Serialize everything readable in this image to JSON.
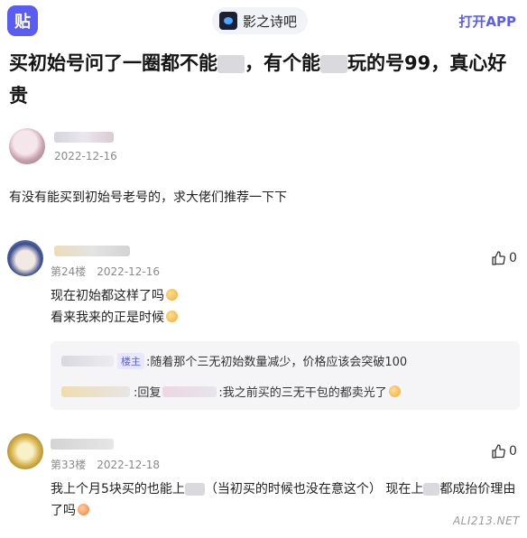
{
  "topbar": {
    "app_icon_glyph": "贴",
    "forum_name": "影之诗吧",
    "open_app_label": "打开APP",
    "accent_color": "#5b5df2"
  },
  "post": {
    "title_part1": "买初始号问了一圈都不能",
    "title_part2": "，有个能",
    "title_part3": "玩的号99，真心好贵",
    "date": "2022-12-16",
    "body": "有没有能买到初始号老号的，求大佬们推荐一下下"
  },
  "replies": [
    {
      "floor": "第24楼",
      "date": "2022-12-16",
      "like_count": "0",
      "line1": "现在初始都这样了吗",
      "line2": "看来我来的正是时候",
      "subreplies": [
        {
          "badge": "楼主",
          "text": ":随着那个三无初始数量减少，价格应该会突破100"
        },
        {
          "prefix": ":回复",
          "text": ":我之前买的三无干包的都卖光了"
        }
      ]
    },
    {
      "floor": "第33楼",
      "date": "2022-12-18",
      "like_count": "0",
      "text_part1": "我上个月5块买的也能上",
      "text_part2": "（当初买的时候也没在意这个） 现在上",
      "text_part3": "都成抬价理由了吗"
    }
  ],
  "watermark": "ALI213.NET",
  "icons": [
    "app-logo-icon",
    "forum-icon",
    "thumb-up-icon",
    "emoji-icon"
  ]
}
